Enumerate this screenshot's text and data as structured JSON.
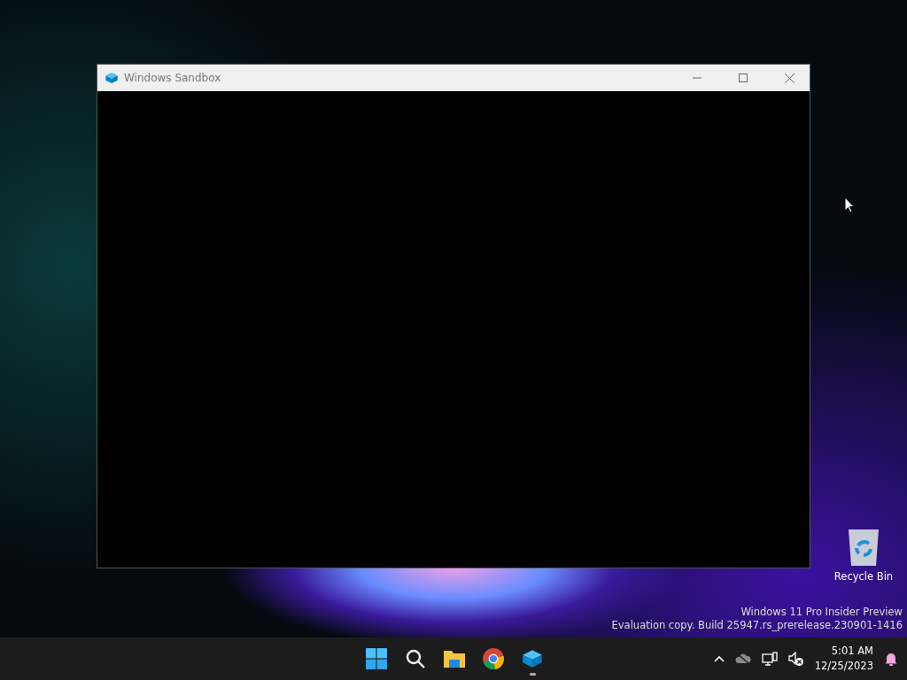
{
  "window": {
    "title": "Windows Sandbox"
  },
  "desktop_icons": [
    {
      "label": "Recycle Bin"
    }
  ],
  "watermark_lines": [
    "Windows 11 Pro Insider Preview",
    "Evaluation copy. Build 25947.rs_prerelease.230901-1416"
  ],
  "taskbar": {
    "apps": [
      {
        "kind": "start",
        "running": false
      },
      {
        "kind": "search",
        "running": false
      },
      {
        "kind": "explorer",
        "running": false
      },
      {
        "kind": "chrome",
        "running": false
      },
      {
        "kind": "sandbox",
        "running": true
      }
    ],
    "tray": {
      "time": "5:01 AM",
      "date": "12/25/2023"
    }
  }
}
